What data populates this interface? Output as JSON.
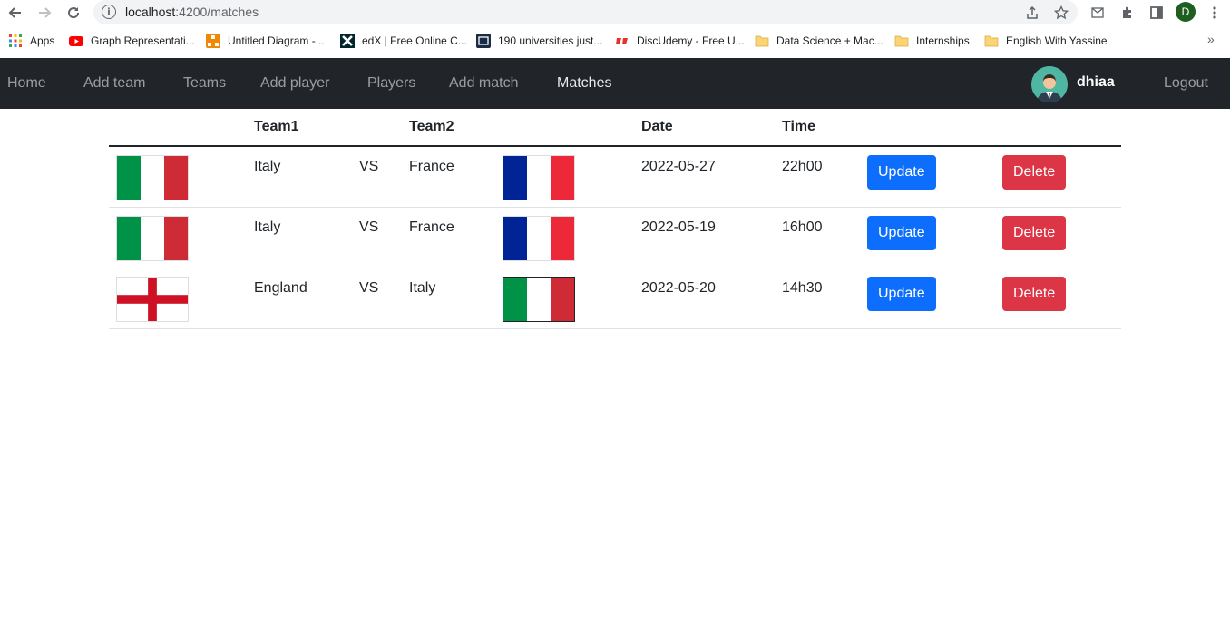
{
  "browser": {
    "url_host": "localhost",
    "url_path": ":4200/matches",
    "profile_initial": "D",
    "bookmarks": [
      {
        "label": "Apps",
        "icon": "apps-grid-icon"
      },
      {
        "label": "Graph Representati...",
        "icon": "youtube-icon"
      },
      {
        "label": "Untitled Diagram -...",
        "icon": "drawio-icon"
      },
      {
        "label": "edX | Free Online C...",
        "icon": "edx-icon"
      },
      {
        "label": "190 universities just...",
        "icon": "news-icon"
      },
      {
        "label": "DiscUdemy - Free U...",
        "icon": "discudemy-icon"
      },
      {
        "label": "Data Science + Mac...",
        "icon": "folder-icon"
      },
      {
        "label": "Internships",
        "icon": "folder-icon"
      },
      {
        "label": "English With Yassine",
        "icon": "folder-icon"
      }
    ]
  },
  "navbar": {
    "links": [
      "Home",
      "Add team",
      "Teams",
      "Add player",
      "Players",
      "Add match",
      "Matches"
    ],
    "active": "Matches",
    "username": "dhiaa",
    "logout": "Logout"
  },
  "table": {
    "headers": {
      "team1": "Team1",
      "team2": "Team2",
      "date": "Date",
      "time": "Time"
    },
    "rows": [
      {
        "team1": "Italy",
        "vs": "VS",
        "team2": "France",
        "flag1": "italy",
        "flag2": "france",
        "date": "2022-05-27",
        "time": "22h00",
        "update": "Update",
        "delete": "Delete"
      },
      {
        "team1": "Italy",
        "vs": "VS",
        "team2": "France",
        "flag1": "italy",
        "flag2": "france",
        "date": "2022-05-19",
        "time": "16h00",
        "update": "Update",
        "delete": "Delete"
      },
      {
        "team1": "England",
        "vs": "VS",
        "team2": "Italy",
        "flag1": "england",
        "flag2": "italy",
        "date": "2022-05-20",
        "time": "14h30",
        "update": "Update",
        "delete": "Delete"
      }
    ]
  },
  "colors": {
    "navbar_bg": "#212529",
    "update_button": "#0d6efd",
    "delete_button": "#dc3545"
  }
}
